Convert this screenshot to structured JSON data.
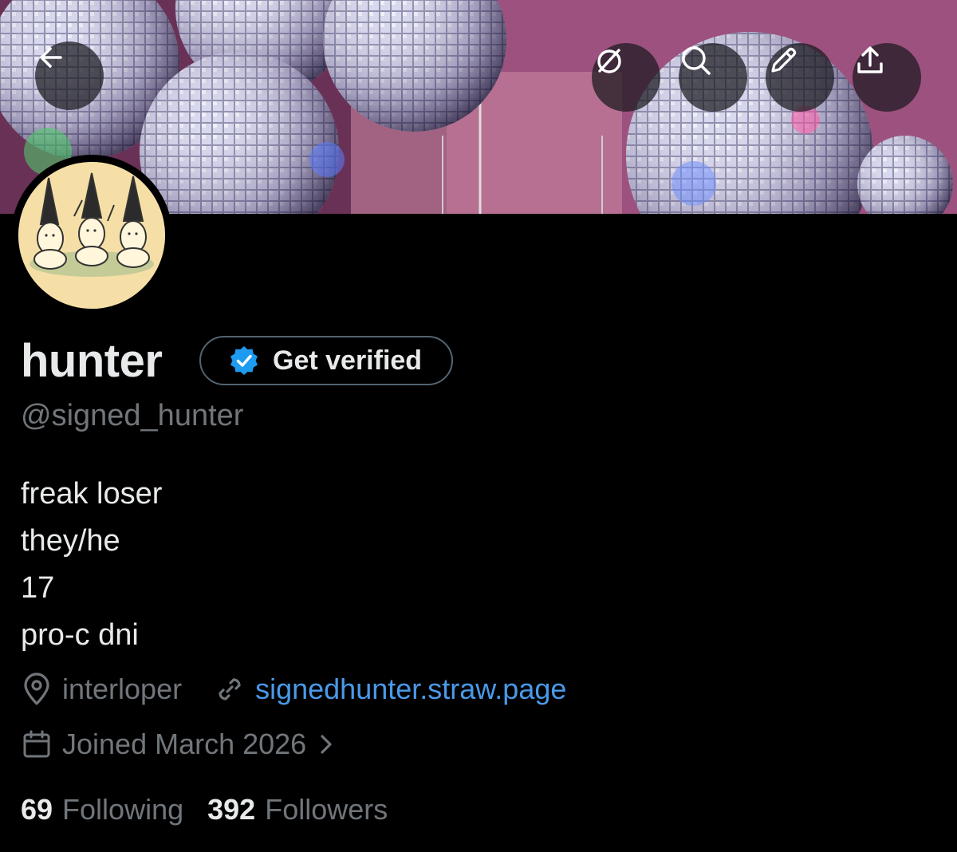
{
  "header": {
    "back_icon": "arrow-left-icon",
    "actions": [
      {
        "icon": "grok-icon"
      },
      {
        "icon": "search-icon"
      },
      {
        "icon": "edit-pencil-icon"
      },
      {
        "icon": "share-icon"
      }
    ]
  },
  "profile": {
    "display_name": "hunter",
    "verify_label": "Get verified",
    "handle": "@signed_hunter",
    "bio_lines": [
      "freak loser",
      "they/he",
      "17",
      "pro-c dni"
    ],
    "location": "interloper",
    "website": "signedhunter.straw.page",
    "joined": "Joined March 2026",
    "following_count": "69",
    "following_label": "Following",
    "followers_count": "392",
    "followers_label": "Followers"
  },
  "colors": {
    "background": "#000000",
    "text_primary": "#e7e9ea",
    "text_secondary": "#71767b",
    "link": "#4a99e9",
    "verified_badge": "#1d9bf0",
    "avatar_bg": "#f5dfa6"
  }
}
